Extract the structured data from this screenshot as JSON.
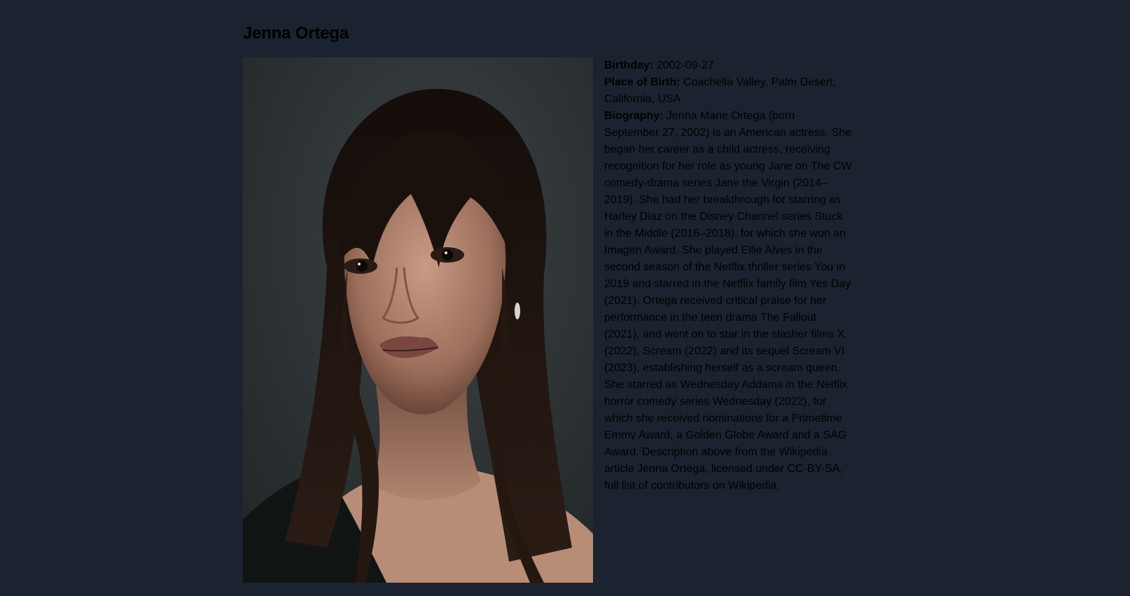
{
  "person": {
    "name": "Jenna Ortega",
    "birthday_label": "Birthday:",
    "birthday": "2002-09-27",
    "place_of_birth_label": "Place of Birth:",
    "place_of_birth": "Coachella Valley, Palm Desert, California, USA",
    "biography_label": "Biography:",
    "biography": "Jenna Marie Ortega (born September 27, 2002) is an American actress. She began her career as a child actress, receiving recognition for her role as young Jane on The CW comedy-drama series Jane the Virgin (2014–2019). She had her breakthrough for starring as Harley Diaz on the Disney Channel series Stuck in the Middle (2016–2018), for which she won an Imagen Award. She played Ellie Alves in the second season of the Netflix thriller series You in 2019 and starred in the Netflix family film Yes Day (2021). Ortega received critical praise for her performance in the teen drama The Fallout (2021), and went on to star in the slasher films X (2022), Scream (2022) and its sequel Scream VI (2023), establishing herself as a scream queen. She starred as Wednesday Addams in the Netflix horror comedy series Wednesday (2022), for which she received nominations for a Primetime Emmy Award, a Golden Globe Award and a SAG Award. Description above from the Wikipedia article Jenna Ortega, licensed under CC-BY-SA, full list of contributors on Wikipedia."
  },
  "colors": {
    "page_background": "#1b2330",
    "text": "#000000",
    "photo_background": "#2e3336"
  }
}
